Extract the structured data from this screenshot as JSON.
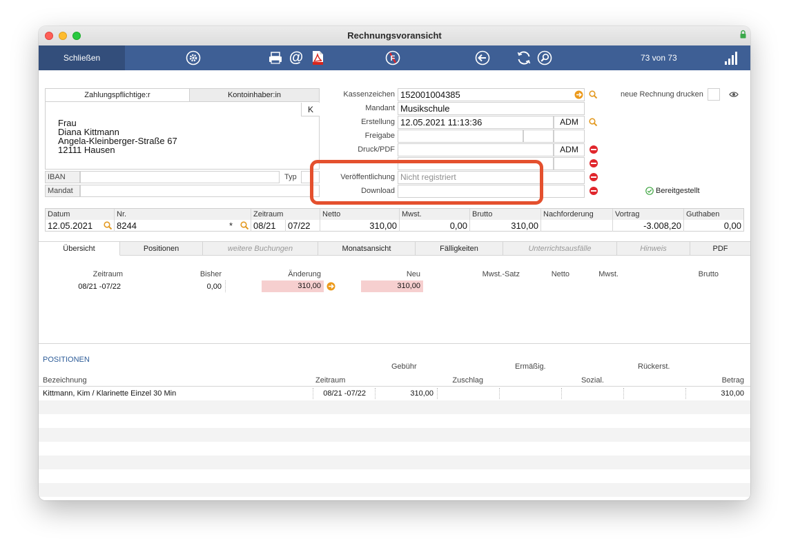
{
  "window": {
    "title": "Rechnungsvoransicht"
  },
  "toolbar": {
    "close_label": "Schließen",
    "record_counter": "73 von 73",
    "icons": [
      "gear-icon",
      "printer-icon",
      "at-icon",
      "pdf-icon",
      "no-entry-icon",
      "arrow-left-icon",
      "refresh-icon",
      "search-icon",
      "signal-bars-icon"
    ]
  },
  "payer": {
    "tab_payer": "Zahlungspflichtige:r",
    "tab_account": "Kontoinhaber:in",
    "k_button": "K",
    "address_lines": [
      "Frau",
      "Diana Kittmann",
      "Angela-Kleinberger-Straße 67",
      "12111 Hausen"
    ],
    "iban_label": "IBAN",
    "iban_value": "",
    "typ_label": "Typ",
    "mandat_label": "Mandat",
    "mandat_value": ""
  },
  "invoice": {
    "kassenzeichen_label": "Kassenzeichen",
    "kassenzeichen_value": "152001004385",
    "mandant_label": "Mandant",
    "mandant_value": "Musikschule",
    "erstellung_label": "Erstellung",
    "erstellung_value": "12.05.2021 11:13:36",
    "erstellung_user": "ADM",
    "freigabe_label": "Freigabe",
    "druck_label": "Druck/PDF",
    "druck_user": "ADM",
    "veroeffentlichung_label": "Veröffentlichung",
    "veroeffentlichung_placeholder": "Nicht registriert",
    "download_label": "Download",
    "neue_rechnung_label": "neue Rechnung drucken",
    "bereitgestellt_label": "Bereitgestellt"
  },
  "summary_grid": {
    "headers": [
      "Datum",
      "Nr.",
      "Zeitraum",
      "Netto",
      "Mwst.",
      "Brutto",
      "Nachforderung",
      "Vortrag",
      "Guthaben"
    ],
    "datum": "12.05.2021",
    "nr": "8244",
    "nr_marker": "*",
    "zeitraum_from": "08/21",
    "zeitraum_to": "07/22",
    "netto": "310,00",
    "mwst": "0,00",
    "brutto": "310,00",
    "nachforderung": "",
    "vortrag": "-3.008,20",
    "guthaben": "0,00"
  },
  "tabs": [
    {
      "label": "Übersicht",
      "state": "active"
    },
    {
      "label": "Positionen",
      "state": "normal"
    },
    {
      "label": "weitere Buchungen",
      "state": "disabled"
    },
    {
      "label": "Monatsansicht",
      "state": "normal"
    },
    {
      "label": "Fälligkeiten",
      "state": "normal"
    },
    {
      "label": "Unterrichtsausfälle",
      "state": "disabled"
    },
    {
      "label": "Hinweis",
      "state": "disabled"
    },
    {
      "label": "PDF",
      "state": "normal"
    }
  ],
  "overview": {
    "headers": {
      "zeitraum": "Zeitraum",
      "bisher": "Bisher",
      "aenderung": "Änderung",
      "neu": "Neu",
      "mwst_satz": "Mwst.-Satz",
      "netto": "Netto",
      "mwst": "Mwst.",
      "brutto": "Brutto"
    },
    "row": {
      "zeitraum": "08/21 -07/22",
      "bisher": "0,00",
      "aenderung": "310,00",
      "neu": "310,00"
    }
  },
  "positions": {
    "section_title": "POSITIONEN",
    "headers_top": {
      "gebuehr": "Gebühr",
      "ermaessig": "Ermäßig.",
      "rueckerst": "Rückerst."
    },
    "headers_bottom": {
      "bezeichnung": "Bezeichnung",
      "zeitraum": "Zeitraum",
      "zuschlag": "Zuschlag",
      "sozial": "Sozial.",
      "betrag": "Betrag"
    },
    "rows": [
      {
        "bezeichnung": "Kittmann, Kim / Klarinette Einzel 30 Min",
        "zeitraum": "08/21 -07/22",
        "gebuehr": "310,00",
        "betrag": "310,00"
      }
    ]
  },
  "colors": {
    "toolbar": "#3e5f95",
    "close_button": "#334e7b",
    "highlight_box": "#e4502e",
    "change_cell": "#f6cfcf",
    "accent_orange": "#ec9a1c",
    "remove_red": "#e0262c"
  }
}
